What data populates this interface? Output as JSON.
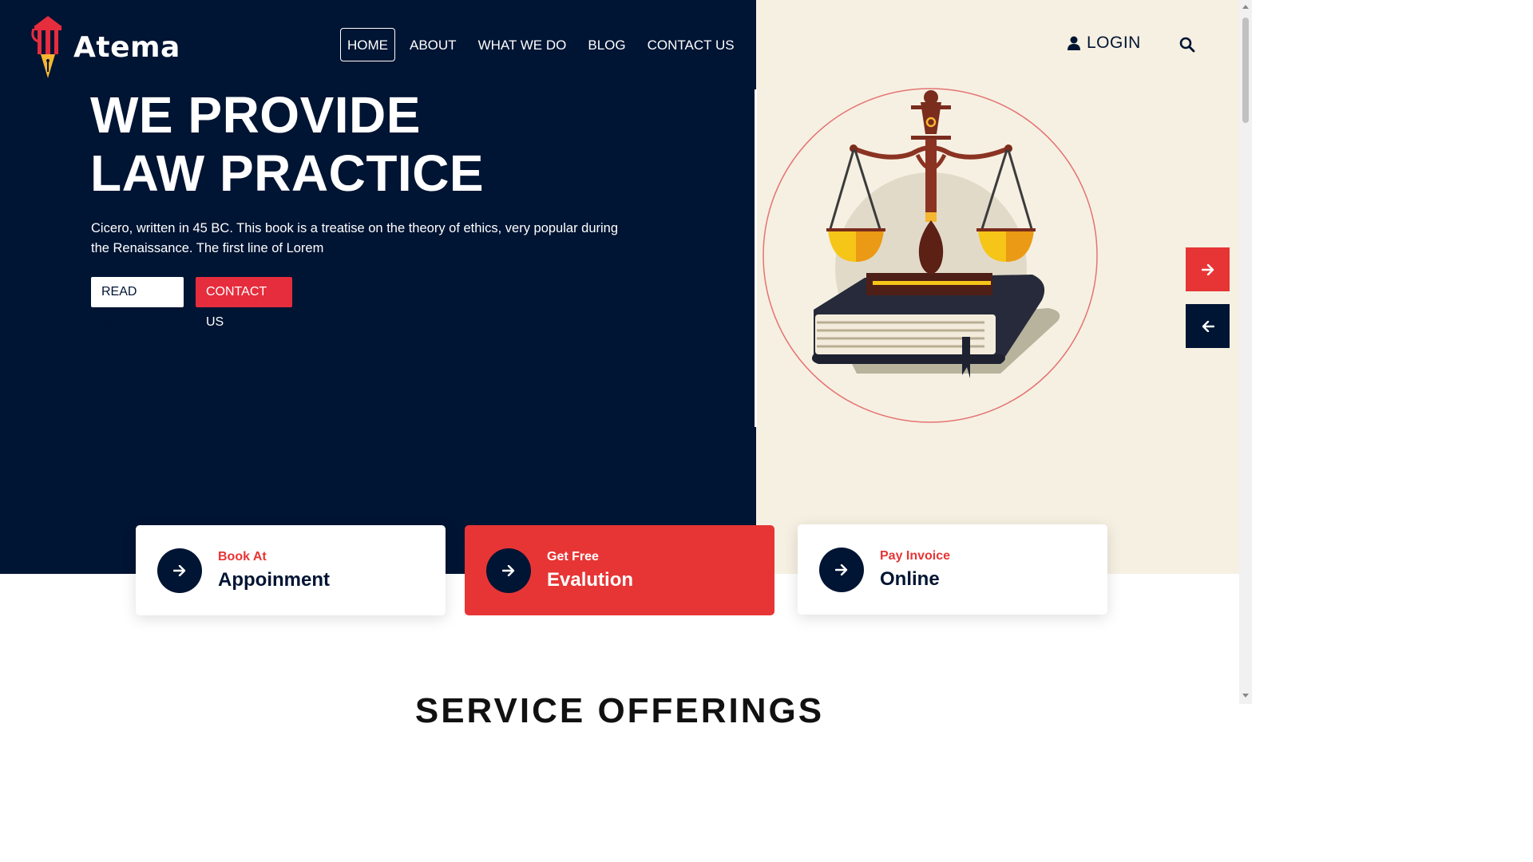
{
  "brand": {
    "name": "Atema"
  },
  "nav": {
    "items": [
      {
        "label": "HOME",
        "active": true
      },
      {
        "label": "ABOUT",
        "active": false
      },
      {
        "label": "WHAT WE DO",
        "active": false
      },
      {
        "label": "BLOG",
        "active": false
      },
      {
        "label": "CONTACT US",
        "active": false
      }
    ],
    "login_label": "LOGIN"
  },
  "hero": {
    "title_line1": "WE PROVIDE",
    "title_line2": "LAW PRACTICE",
    "description": "Cicero, written in 45 BC. This book is a treatise on the theory of ethics, very popular during the Renaissance. The first line of Lorem",
    "read_more_label": "READ MORE",
    "contact_label": "CONTACT US"
  },
  "cards": [
    {
      "small": "Book At",
      "big": "Appoinment"
    },
    {
      "small": "Get Free",
      "big": "Evalution"
    },
    {
      "small": "Pay Invoice",
      "big": "Online"
    }
  ],
  "section": {
    "title": "SERVICE OFFERINGS"
  },
  "colors": {
    "navy": "#001433",
    "red": "#e73535",
    "cream": "#f6f0e2",
    "white": "#ffffff"
  },
  "icons": [
    "logo-pillar-pen-icon",
    "user-icon",
    "search-icon",
    "arrow-right-icon",
    "arrow-left-icon",
    "justice-scales-book-illustration"
  ]
}
